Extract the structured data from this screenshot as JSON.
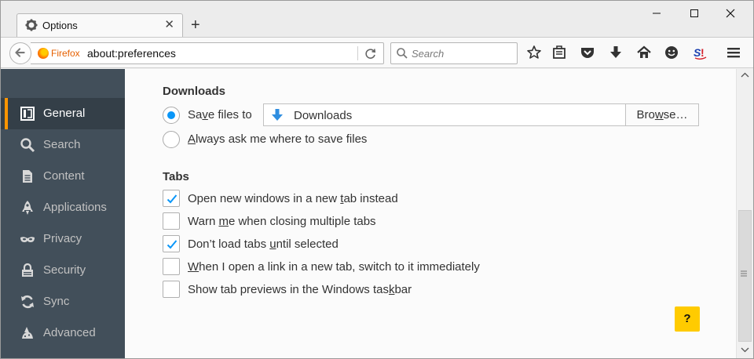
{
  "tab": {
    "title": "Options",
    "close_glyph": "✕",
    "new_tab_glyph": "+"
  },
  "window_controls": [
    "minimize-icon",
    "maximize-icon",
    "close-icon"
  ],
  "navbar": {
    "identity_label": "Firefox",
    "url": "about:preferences",
    "search_placeholder": "Search",
    "toolbar_icons": [
      "bookmark-star-icon",
      "reading-list-icon",
      "pocket-icon",
      "download-icon",
      "home-icon",
      "smiley-icon",
      "extension-icon",
      "menu-icon"
    ]
  },
  "sidebar": {
    "items": [
      {
        "label": "General",
        "icon": "general-icon",
        "selected": true
      },
      {
        "label": "Search",
        "icon": "search-icon",
        "selected": false
      },
      {
        "label": "Content",
        "icon": "content-icon",
        "selected": false
      },
      {
        "label": "Applications",
        "icon": "applications-icon",
        "selected": false
      },
      {
        "label": "Privacy",
        "icon": "privacy-mask-icon",
        "selected": false
      },
      {
        "label": "Security",
        "icon": "security-lock-icon",
        "selected": false
      },
      {
        "label": "Sync",
        "icon": "sync-icon",
        "selected": false
      },
      {
        "label": "Advanced",
        "icon": "advanced-wizard-icon",
        "selected": false
      }
    ]
  },
  "downloads": {
    "title": "Downloads",
    "save_files_label": "Save files to",
    "save_files_checked": true,
    "folder": "Downloads",
    "browse_label": "Browse…",
    "always_ask_label": "Always ask me where to save files",
    "always_ask_checked": false
  },
  "tabs_section": {
    "title": "Tabs",
    "options": [
      {
        "label": "Open new windows in a new tab instead",
        "checked": true
      },
      {
        "label": "Warn me when closing multiple tabs",
        "checked": false
      },
      {
        "label": "Don't load tabs until selected",
        "checked": true
      },
      {
        "label": "When I open a link in a new tab, switch to it immediately",
        "checked": false
      },
      {
        "label": "Show tab previews in the Windows taskbar",
        "checked": false
      }
    ]
  },
  "help_label": "?",
  "colors": {
    "accent": "#0996f8",
    "selected_bar": "#ff9500",
    "sidebar_bg": "#424f5a",
    "help_bg": "#ffcb00"
  }
}
